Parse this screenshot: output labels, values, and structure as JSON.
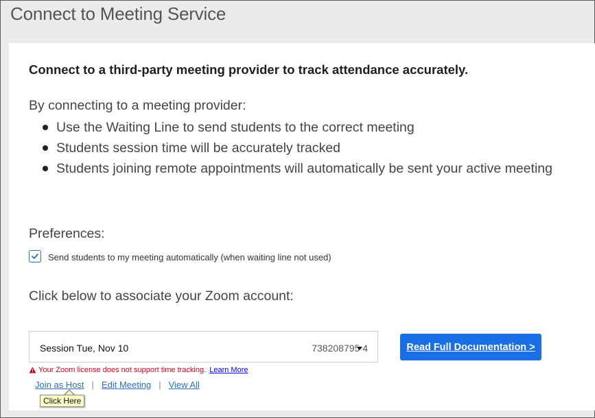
{
  "window": {
    "title": "Connect to Meeting Service"
  },
  "main": {
    "heading": "Connect to a third-party meeting provider to track attendance accurately.",
    "intro": "By connecting to a meeting provider:",
    "bullets": [
      "Use the Waiting Line to send students to the correct meeting",
      "Students session time will be accurately tracked",
      "Students joining remote appointments will automatically be sent your active meeting"
    ]
  },
  "preferences": {
    "title": "Preferences:",
    "auto_send": {
      "checked": true,
      "label": "Send students to my meeting automatically (when waiting line not used)"
    }
  },
  "zoom": {
    "prompt": "Click below to associate your Zoom account:",
    "session_name": "Session Tue, Nov 10",
    "session_id": "738208795 4",
    "doc_button": "Read Full Documentation >",
    "warning": "Your Zoom license does not support time tracking.",
    "learn_more": "Learn More",
    "links": {
      "join_host": "Join as Host",
      "edit_meeting": "Edit Meeting",
      "view_all": "View All"
    },
    "separator": "|",
    "tooltip": "Click Here"
  },
  "colors": {
    "accent": "#1a6fe6",
    "warning": "#d0021b",
    "link": "#2a6fbf",
    "tooltip_bg": "#ffffc8"
  },
  "icons": [
    "checkmark-icon",
    "warning-triangle-icon",
    "caret-down-icon"
  ]
}
